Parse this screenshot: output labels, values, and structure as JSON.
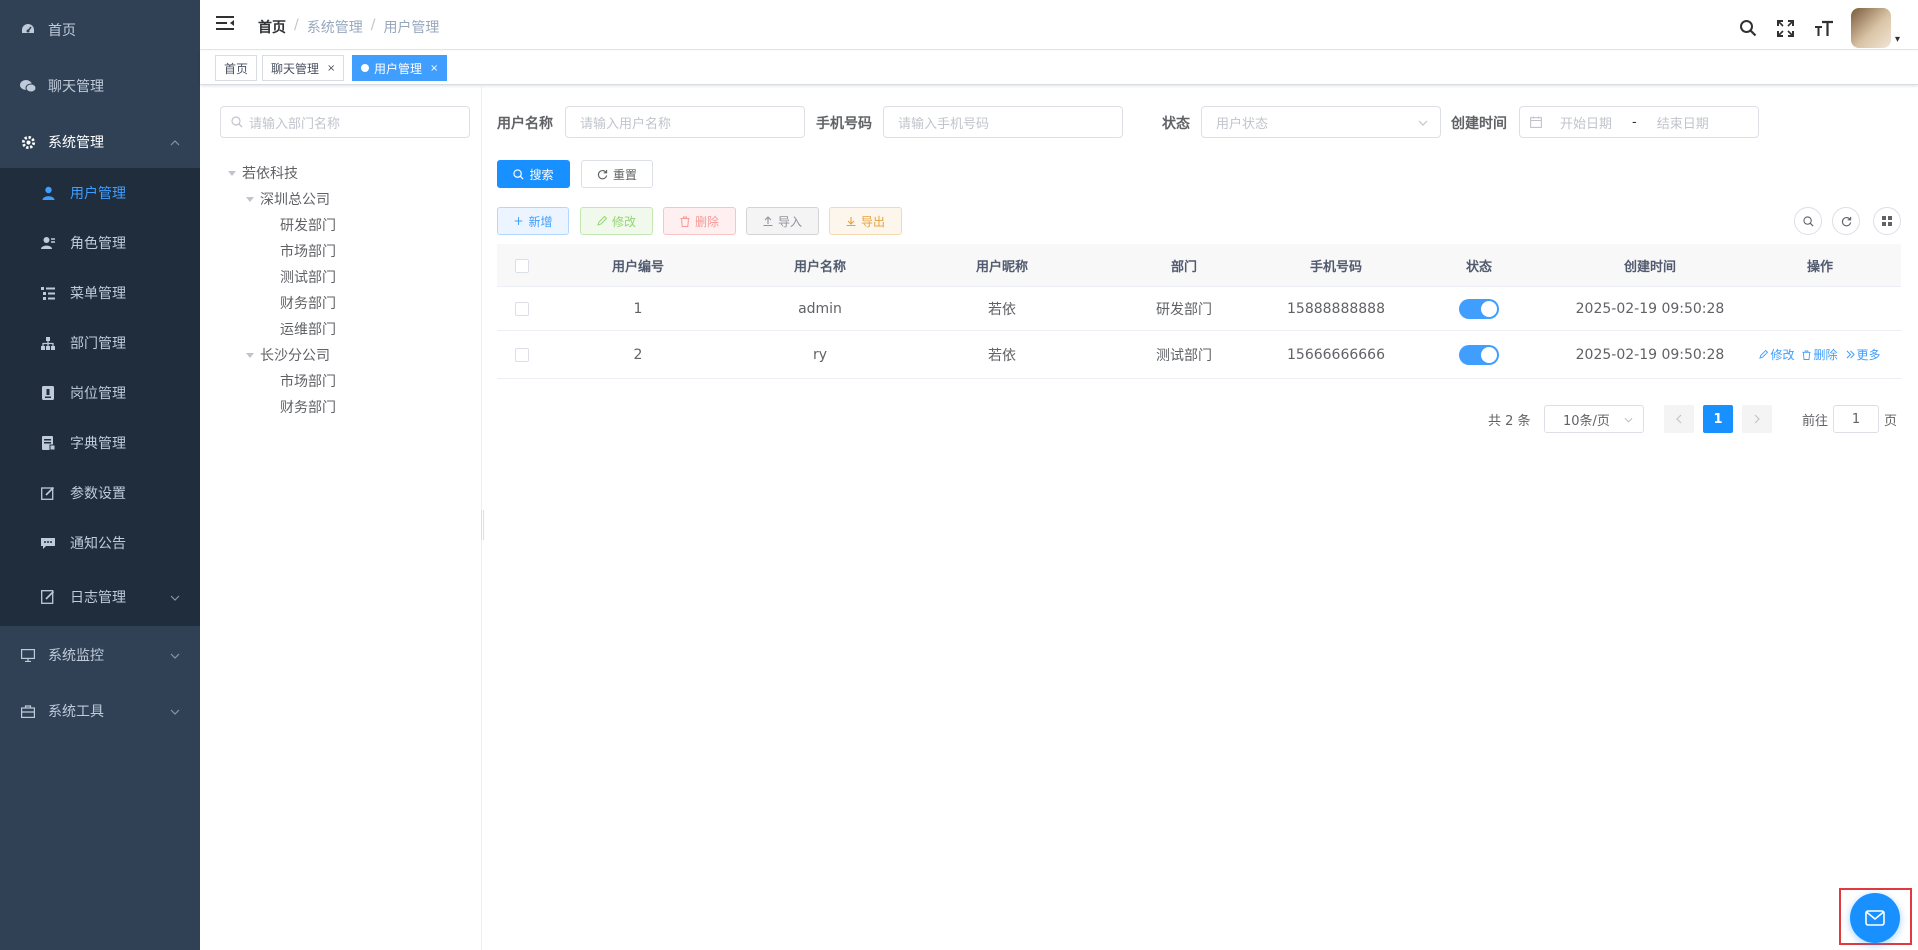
{
  "sidebar": {
    "items": [
      {
        "label": "首页",
        "icon": "dashboard-icon"
      },
      {
        "label": "聊天管理",
        "icon": "wechat-icon"
      },
      {
        "label": "系统管理",
        "icon": "gear-icon"
      },
      {
        "label": "系统监控",
        "icon": "monitor-icon"
      },
      {
        "label": "系统工具",
        "icon": "toolbox-icon"
      }
    ],
    "system_sub": [
      {
        "label": "用户管理",
        "icon": "user-icon"
      },
      {
        "label": "角色管理",
        "icon": "role-icon"
      },
      {
        "label": "菜单管理",
        "icon": "menu-list-icon"
      },
      {
        "label": "部门管理",
        "icon": "org-tree-icon"
      },
      {
        "label": "岗位管理",
        "icon": "post-icon"
      },
      {
        "label": "字典管理",
        "icon": "dictionary-icon"
      },
      {
        "label": "参数设置",
        "icon": "edit-icon"
      },
      {
        "label": "通知公告",
        "icon": "message-icon"
      },
      {
        "label": "日志管理",
        "icon": "log-icon"
      }
    ]
  },
  "navbar": {
    "breadcrumb": [
      "首页",
      "系统管理",
      "用户管理"
    ],
    "sep": "/",
    "caret": "▾"
  },
  "tags": [
    {
      "label": "首页"
    },
    {
      "label": "聊天管理",
      "close": "×"
    },
    {
      "label": "用户管理",
      "close": "×"
    }
  ],
  "tree": {
    "search_placeholder": "请输入部门名称",
    "nodes": [
      "若依科技",
      "深圳总公司",
      "研发部门",
      "市场部门",
      "测试部门",
      "财务部门",
      "运维部门",
      "长沙分公司",
      "市场部门",
      "财务部门"
    ]
  },
  "search_form": {
    "username_label": "用户名称",
    "username_placeholder": "请输入用户名称",
    "phone_label": "手机号码",
    "phone_placeholder": "请输入手机号码",
    "status_label": "状态",
    "status_placeholder": "用户状态",
    "created_label": "创建时间",
    "start_placeholder": "开始日期",
    "range_sep": "-",
    "end_placeholder": "结束日期",
    "search_btn": "搜索",
    "reset_btn": "重置"
  },
  "toolbar": {
    "add": "新增",
    "edit": "修改",
    "delete": "删除",
    "import": "导入",
    "export": "导出"
  },
  "table": {
    "columns": [
      "用户编号",
      "用户名称",
      "用户昵称",
      "部门",
      "手机号码",
      "状态",
      "创建时间",
      "操作"
    ],
    "rows": [
      {
        "id": "1",
        "username": "admin",
        "nickname": "若依",
        "dept": "研发部门",
        "phone": "15888888888",
        "status_on": true,
        "created": "2025-02-19 09:50:28",
        "ops": []
      },
      {
        "id": "2",
        "username": "ry",
        "nickname": "若依",
        "dept": "测试部门",
        "phone": "15666666666",
        "status_on": true,
        "created": "2025-02-19 09:50:28",
        "ops": [
          "修改",
          "删除",
          "更多"
        ]
      }
    ]
  },
  "pagination": {
    "total": "共 2 条",
    "page_size": "10条/页",
    "current": "1",
    "goto_label": "前往",
    "goto_value": "1",
    "page_unit": "页"
  },
  "colors": {
    "sidebar_bg": "#304156",
    "submenu_bg": "#1f2d3d",
    "primary": "#409eff",
    "highlight_outline": "#e0393e"
  }
}
